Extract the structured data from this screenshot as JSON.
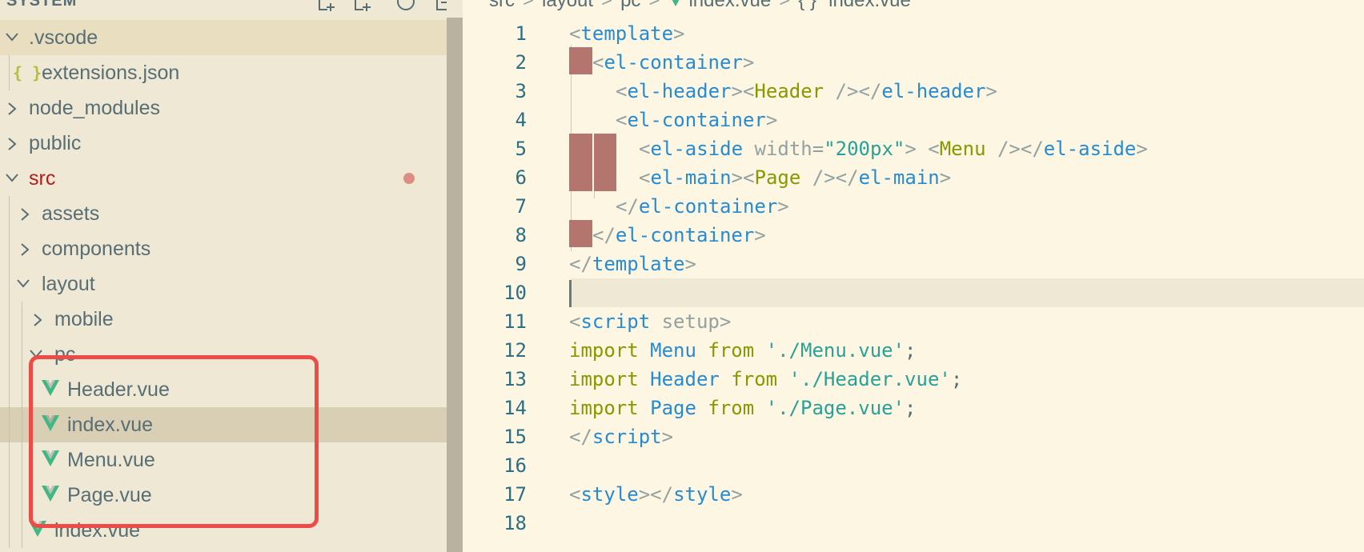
{
  "sidebar": {
    "title": "SYSTEM",
    "actions": [
      "new-file-icon",
      "new-folder-icon",
      "refresh-icon",
      "collapse-all-icon"
    ],
    "items": [
      {
        "label": ".vscode",
        "kind": "folder",
        "expanded": true
      },
      {
        "label": "extensions.json",
        "kind": "json-file",
        "icon_text": "{ }"
      },
      {
        "label": "node_modules",
        "kind": "folder",
        "expanded": false
      },
      {
        "label": "public",
        "kind": "folder",
        "expanded": false
      },
      {
        "label": "src",
        "kind": "folder",
        "expanded": true,
        "modified": true
      },
      {
        "label": "assets",
        "kind": "folder",
        "expanded": false
      },
      {
        "label": "components",
        "kind": "folder",
        "expanded": false
      },
      {
        "label": "layout",
        "kind": "folder",
        "expanded": true
      },
      {
        "label": "mobile",
        "kind": "folder",
        "expanded": false
      },
      {
        "label": "pc",
        "kind": "folder",
        "expanded": true
      },
      {
        "label": "Header.vue",
        "kind": "vue-file"
      },
      {
        "label": "index.vue",
        "kind": "vue-file",
        "selected": true
      },
      {
        "label": "Menu.vue",
        "kind": "vue-file"
      },
      {
        "label": "Page.vue",
        "kind": "vue-file"
      },
      {
        "label": "index.vue",
        "kind": "vue-file"
      }
    ],
    "modified_color": "#dc8d86",
    "annotation_color": "#ee4b46"
  },
  "breadcrumb": {
    "parts": [
      "src",
      "layout",
      "pc",
      "index.vue",
      "{ } \"index.vue\""
    ]
  },
  "editor": {
    "line_numbers": [
      "1",
      "2",
      "3",
      "4",
      "5",
      "6",
      "7",
      "8",
      "9",
      "10",
      "11",
      "12",
      "13",
      "14",
      "15",
      "16",
      "17",
      "18"
    ],
    "lines": {
      "l1": {
        "lt": "<",
        "tag": "template",
        "gt": ">"
      },
      "l2": {
        "lt": "<",
        "tag": "el-container",
        "gt": ">"
      },
      "l3": {
        "lt1": "<",
        "tag1": "el-header",
        "gt1": ">",
        "lt2": "<",
        "comp": "Header",
        "selfclose": " />",
        "lt3": "</",
        "tag3": "el-header",
        "gt3": ">"
      },
      "l4": {
        "lt": "<",
        "tag": "el-container",
        "gt": ">"
      },
      "l5": {
        "lt1": "<",
        "tag1": "el-aside",
        "attr": " width",
        "eq": "=",
        "str": "\"200px\"",
        "gt1": ">",
        "sp": " ",
        "lt2": "<",
        "comp": "Menu",
        "selfclose": " />",
        "lt3": "</",
        "tag3": "el-aside",
        "gt3": ">"
      },
      "l6": {
        "lt1": "<",
        "tag1": "el-main",
        "gt1": ">",
        "lt2": "<",
        "comp": "Page",
        "selfclose": " />",
        "lt3": "</",
        "tag3": "el-main",
        "gt3": ">"
      },
      "l7": {
        "lt": "</",
        "tag": "el-container",
        "gt": ">"
      },
      "l8": {
        "lt": "</",
        "tag": "el-container",
        "gt": ">"
      },
      "l9": {
        "lt": "</",
        "tag": "template",
        "gt": ">"
      },
      "l11": {
        "lt": "<",
        "tag": "script",
        "attr": " setup",
        "gt": ">"
      },
      "l12": {
        "kw": "import",
        "ident": " Menu",
        "from": " from",
        "str": " './Menu.vue'",
        "semi": ";"
      },
      "l13": {
        "kw": "import",
        "ident": " Header",
        "from": " from",
        "str": " './Header.vue'",
        "semi": ";"
      },
      "l14": {
        "kw": "import",
        "ident": " Page",
        "from": " from",
        "str": " './Page.vue'",
        "semi": ";"
      },
      "l15": {
        "lt": "</",
        "tag": "script",
        "gt": ">"
      },
      "l17": {
        "lt1": "<",
        "tag1": "style",
        "gt1": ">",
        "lt2": "</",
        "tag2": "style",
        "gt2": ">"
      }
    },
    "colors": {
      "tag": "#268bd2",
      "component": "#859900",
      "string": "#2aa198",
      "keyword": "#859900",
      "indent_error": "#b5756f"
    }
  }
}
